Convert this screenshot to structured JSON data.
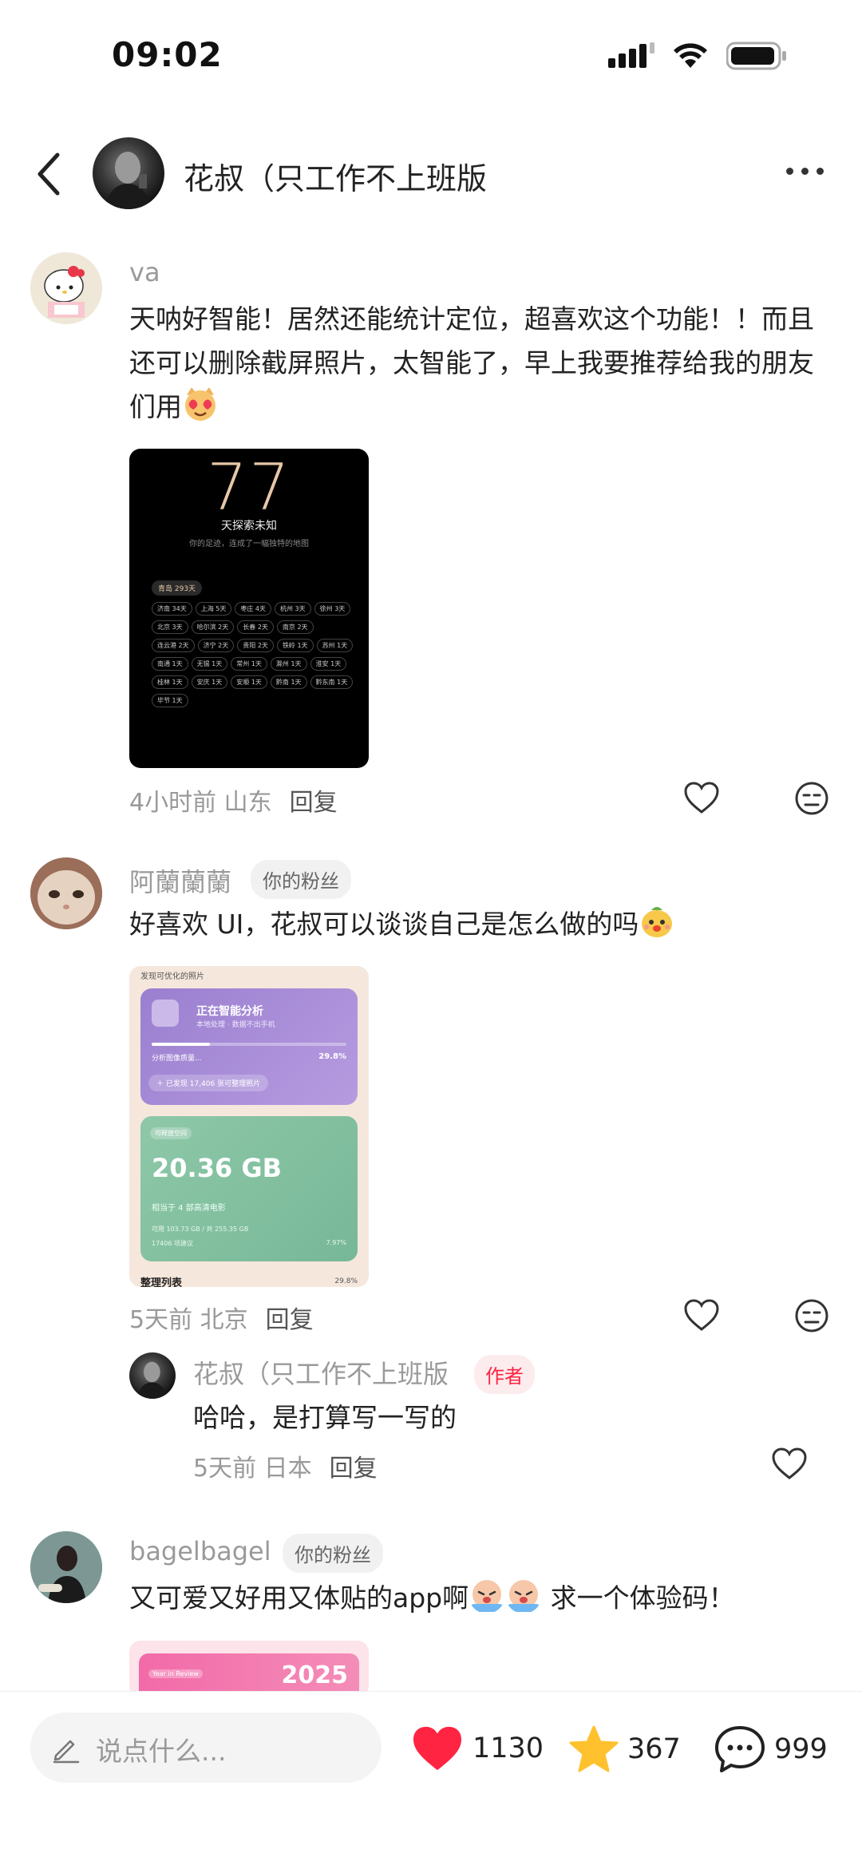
{
  "status_bar": {
    "time": "09:02"
  },
  "header": {
    "title": "花叔（只工作不上班版"
  },
  "comments": [
    {
      "name": "va",
      "text": "天呐好智能！居然还能统计定位，超喜欢这个功能！！而且还可以删除截屏照片，太智能了，早上我要推荐给我的朋友们用",
      "time_location": "4小时前 山东",
      "reply_label": "回复",
      "image": {
        "big_number": "77",
        "title": "天探索未知",
        "subtitle": "你的足迹，连成了一幅独特的地图",
        "home_city": "青岛 293天",
        "cities": [
          "济南 34天",
          "上海 5天",
          "枣庄 4天",
          "杭州 3天",
          "徐州 3天",
          "北京 3天",
          "哈尔滨 2天",
          "长春 2天",
          "南京 2天",
          "连云港 2天",
          "济宁 2天",
          "贵阳 2天",
          "铁岭 1天",
          "苏州 1天",
          "南通 1天",
          "无锡 1天",
          "常州 1天",
          "滁州 1天",
          "淮安 1天",
          "桂林 1天",
          "安庆 1天",
          "安顺 1天",
          "黔南 1天",
          "黔东南 1天",
          "毕节 1天"
        ]
      }
    },
    {
      "name": "阿蘭蘭蘭",
      "badge": "你的粉丝",
      "text": "好喜欢 UI，花叔可以谈谈自己是怎么做的吗",
      "time_location": "5天前 北京",
      "reply_label": "回复",
      "image": {
        "top_label": "发现可优化的照片",
        "analyzing_title": "正在智能分析",
        "analyzing_sub": "本地处理 · 数据不出手机",
        "progress_label": "分析图像质量...",
        "progress_pct": "29.8%",
        "progress_value": 0.298,
        "found_text": "已发现 17,406 张可整理照片",
        "free_label": "可释放空间",
        "size": "20.36 GB",
        "equiv": "相当于 4 部高清电影",
        "storage": "可用 103.73 GB / 共 255.35 GB",
        "suggest": "17406 项建议",
        "suggest_pct": "7.97%",
        "bottom_title": "整理列表",
        "bottom_pct": "29.8%"
      },
      "reply": {
        "name": "花叔（只工作不上班版",
        "badge": "作者",
        "text": "哈哈，是打算写一写的",
        "time_location": "5天前 日本",
        "reply_label": "回复"
      }
    },
    {
      "name": "bagelbagel",
      "badge": "你的粉丝",
      "text_before": "又可爱又好用又体贴的app啊",
      "text_after": " 求一个体验码！",
      "image": {
        "tag": "Year in Review",
        "year": "2025"
      }
    }
  ],
  "bottom_bar": {
    "input_placeholder": "说点什么...",
    "likes": "1130",
    "favorites": "367",
    "comments": "999"
  },
  "colors": {
    "accent_red": "#ff2442",
    "star": "#ffc12e",
    "text_gray": "#999999"
  }
}
